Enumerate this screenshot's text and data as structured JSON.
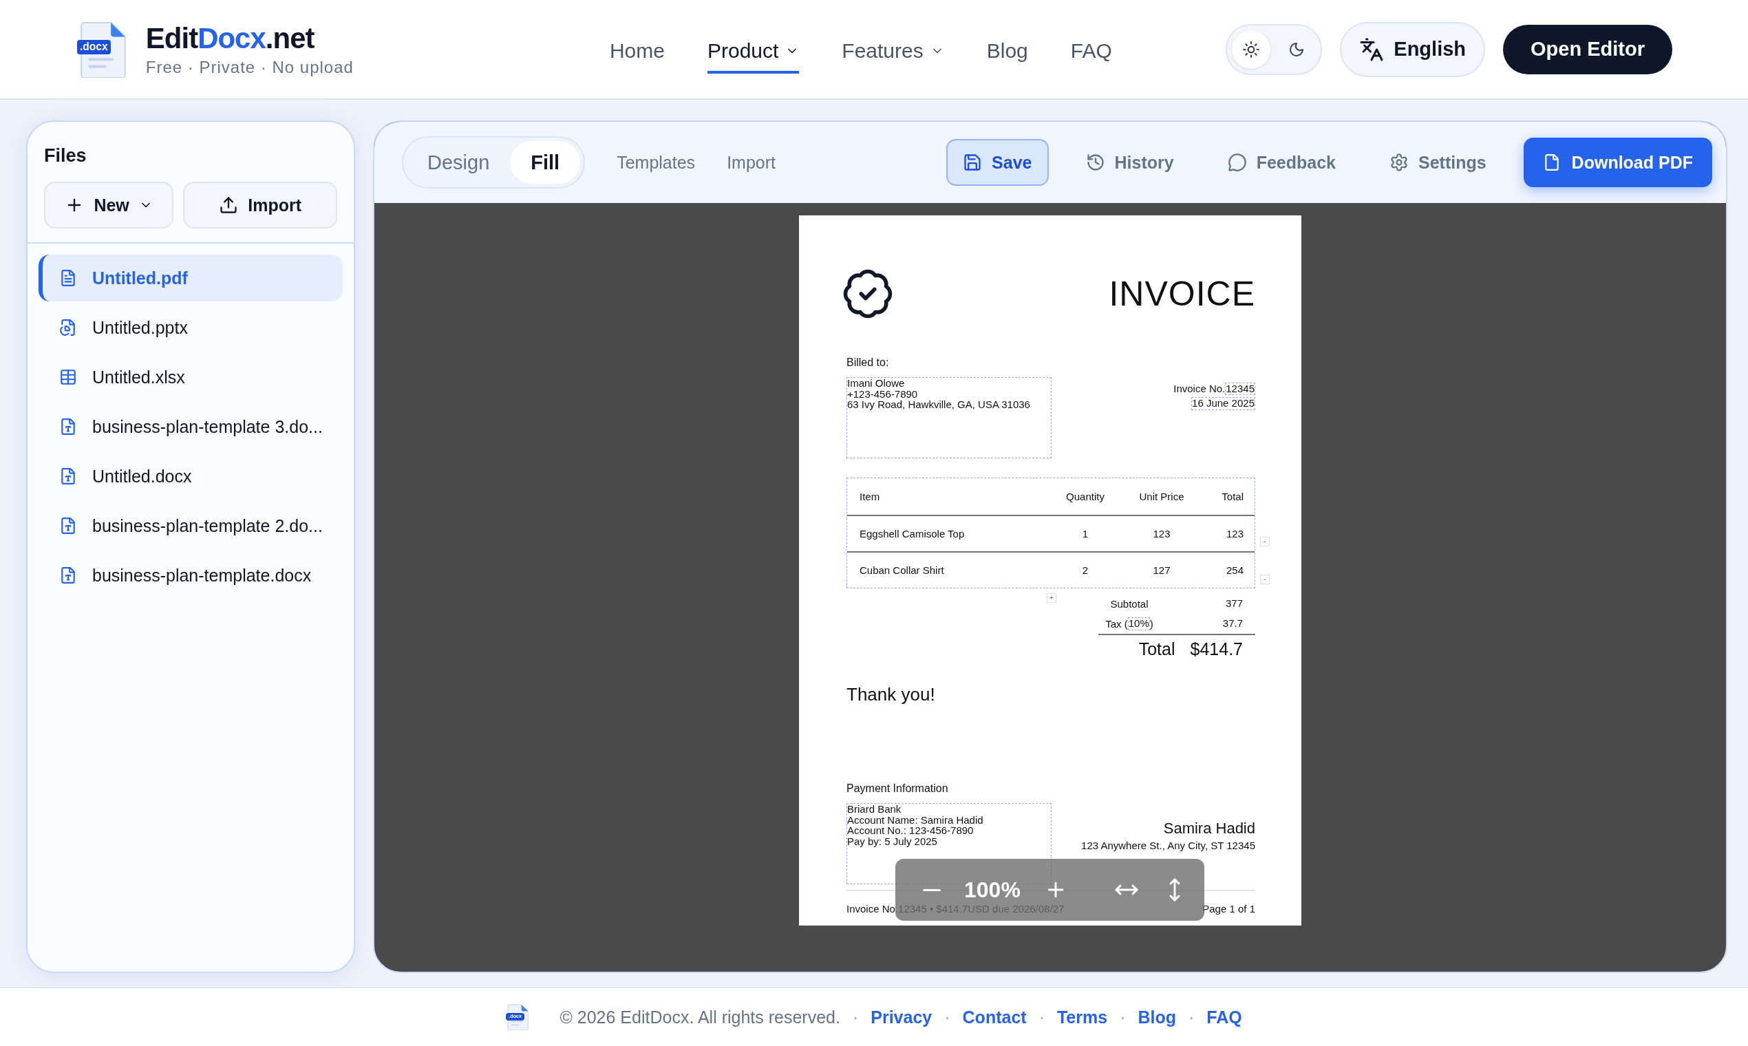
{
  "header": {
    "logo_badge": ".docx",
    "brand": {
      "prefix": "Edit",
      "highlight": "Docx",
      "suffix": ".net"
    },
    "tagline": "Free · Private · No upload",
    "nav": [
      {
        "label": "Home",
        "selected": false,
        "has_menu": false
      },
      {
        "label": "Product",
        "selected": true,
        "has_menu": true
      },
      {
        "label": "Features",
        "selected": false,
        "has_menu": true
      },
      {
        "label": "Blog",
        "selected": false,
        "has_menu": false
      },
      {
        "label": "FAQ",
        "selected": false,
        "has_menu": false
      }
    ],
    "theme": [
      {
        "kind": "light",
        "selected": true
      },
      {
        "kind": "dark",
        "selected": false
      }
    ],
    "language": "English",
    "open_editor": "Open Editor"
  },
  "sidebar": {
    "title": "Files",
    "buttons": [
      {
        "kind": "new",
        "label": "New"
      },
      {
        "kind": "import",
        "label": "Import"
      }
    ],
    "files": [
      {
        "name": "Untitled.pdf",
        "kind": "pdf",
        "selected": true
      },
      {
        "name": "Untitled.pptx",
        "kind": "pptx",
        "selected": false
      },
      {
        "name": "Untitled.xlsx",
        "kind": "xlsx",
        "selected": false
      },
      {
        "name": "business-plan-template 3.do...",
        "kind": "docx",
        "selected": false
      },
      {
        "name": "Untitled.docx",
        "kind": "docx",
        "selected": false
      },
      {
        "name": "business-plan-template 2.do...",
        "kind": "docx",
        "selected": false
      },
      {
        "name": "business-plan-template.docx",
        "kind": "docx",
        "selected": false
      }
    ]
  },
  "toolbar": {
    "modes": [
      {
        "label": "Design",
        "selected": false
      },
      {
        "label": "Fill",
        "selected": true
      }
    ],
    "links": [
      "Templates",
      "Import"
    ],
    "actions": [
      {
        "kind": "save",
        "label": "Save"
      },
      {
        "kind": "history",
        "label": "History"
      },
      {
        "kind": "feedback",
        "label": "Feedback"
      },
      {
        "kind": "settings",
        "label": "Settings"
      }
    ],
    "download": "Download PDF"
  },
  "document": {
    "title": "INVOICE",
    "billed_label": "Billed to:",
    "client": [
      "Imani Olowe",
      "+123-456-7890",
      "63 Ivy Road, Hawkville, GA, USA 31036"
    ],
    "invoice_no_label": "Invoice No.",
    "invoice_no": "12345",
    "date": "16 June 2025",
    "table": {
      "columns": [
        "Item",
        "Quantity",
        "Unit Price",
        "Total"
      ],
      "rows": [
        {
          "cells": [
            "Eggshell Camisole Top",
            "1",
            "123",
            "123"
          ],
          "remove": "-"
        },
        {
          "cells": [
            "Cuban Collar Shirt",
            "2",
            "127",
            "254"
          ],
          "remove": "-"
        }
      ],
      "add": "+"
    },
    "subtotal_label": "Subtotal",
    "subtotal": "377",
    "tax_prefix": "Tax (",
    "tax_rate": "10%",
    "tax_suffix": ")",
    "tax": "37.7",
    "total_label": "Total",
    "total": "$414.7",
    "thanks": "Thank you!",
    "payment_label": "Payment Information",
    "payment": [
      "Briard Bank",
      "Account Name: Samira Hadid",
      "Account No.: 123-456-7890",
      "Pay by: 5 July 2025"
    ],
    "issuer": "Samira Hadid",
    "issuer_address": "123 Anywhere St., Any City, ST 12345",
    "footer_left": "Invoice No.12345  •  $414.7USD due 2026/08/27",
    "footer_right": "Page 1 of 1"
  },
  "zoom": {
    "level": "100%"
  },
  "footer": {
    "logo_badge": ".docx",
    "copyright": "© 2026 EditDocx. All rights reserved.",
    "separator": "·",
    "links": [
      "Privacy",
      "Contact",
      "Terms",
      "Blog",
      "FAQ"
    ]
  }
}
